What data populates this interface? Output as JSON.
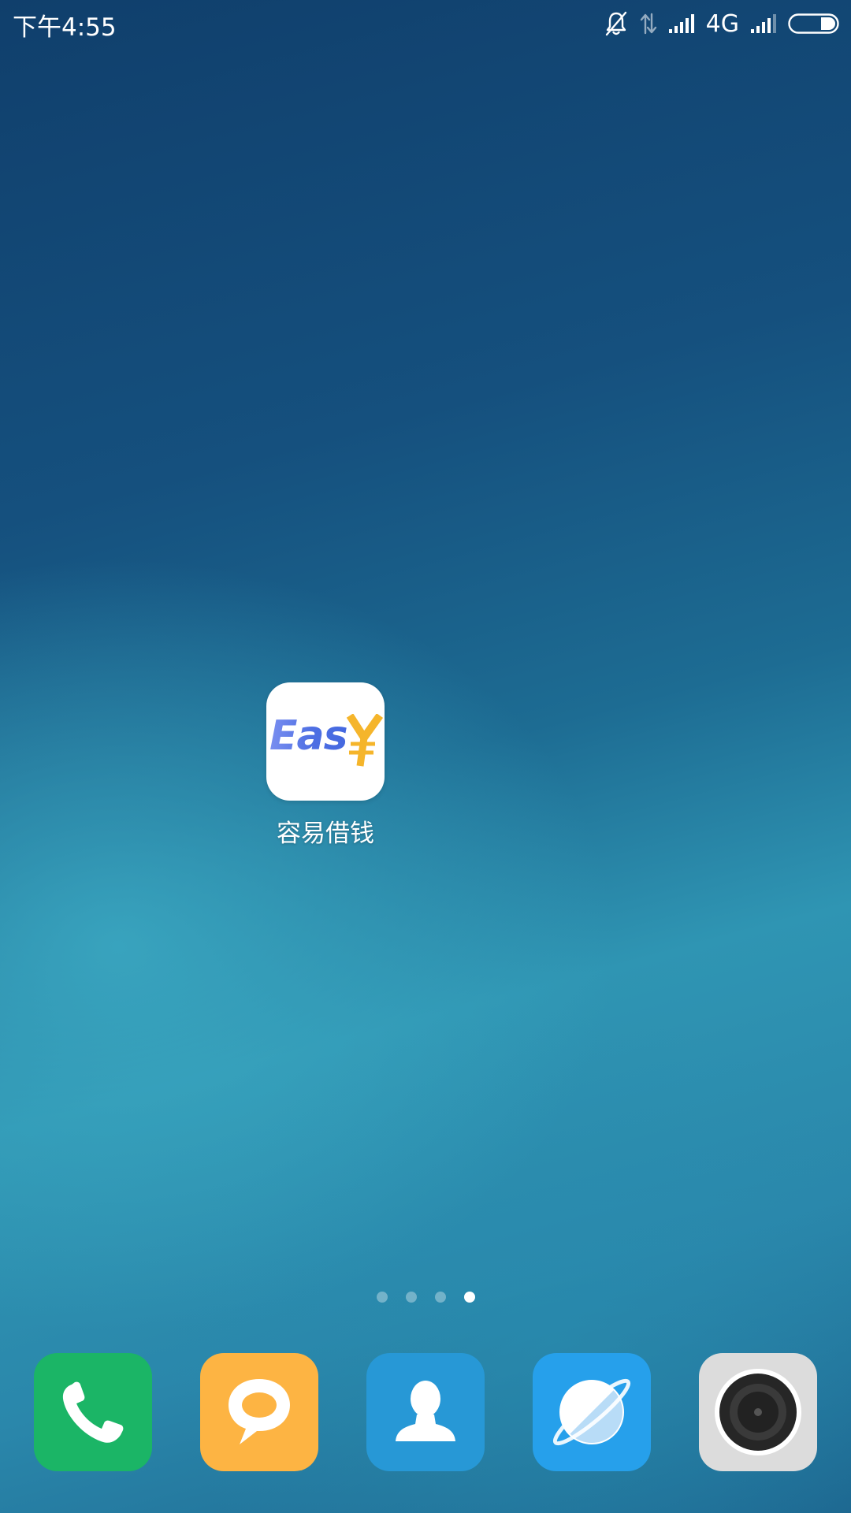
{
  "status_bar": {
    "time": "下午4:55",
    "network_type": "4G",
    "icons": [
      "mute-bell-icon",
      "data-transfer-icon",
      "signal-icon",
      "signal-icon-2",
      "battery-icon"
    ]
  },
  "home_screen": {
    "apps": [
      {
        "label": "容易借钱",
        "icon": "easy-loan-app-icon",
        "tile_text": "Eas",
        "tile_color": "#ffffff",
        "brand_color": "#4e6fe3",
        "accent_color": "#f5b52b"
      }
    ],
    "page_indicator": {
      "pages": 4,
      "current_page": 4
    }
  },
  "dock": {
    "apps": [
      {
        "icon": "phone-icon",
        "color": "#1bb566"
      },
      {
        "icon": "messages-icon",
        "color": "#fdb443"
      },
      {
        "icon": "contacts-icon",
        "color": "#2798d6"
      },
      {
        "icon": "browser-icon",
        "color": "#26a0eb"
      },
      {
        "icon": "camera-icon",
        "color": "#dcdcdc"
      }
    ]
  }
}
